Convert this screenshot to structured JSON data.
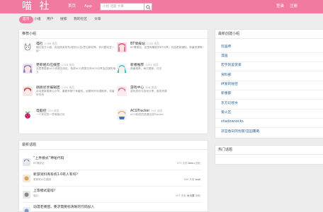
{
  "header": {
    "logo": "喵 社",
    "nav": [
      "首页",
      "App"
    ],
    "search_placeholder": "小组 话题 文章",
    "login": "登录",
    "register": "注册"
  },
  "subnav": [
    "首页",
    "小组",
    "用户",
    "搜索",
    "我的社区",
    "文章"
  ],
  "recommend": {
    "title": "推荐小组",
    "groups": [
      {
        "name": "喵社",
        "count": "1186 成员",
        "desc": "喵社官方小组，欢迎使用发布/规则/公告/意见和帖等，有问题也在一起~",
        "avatar": "cat"
      },
      {
        "name": "BT情报站",
        "count": "1150 成员",
        "desc": "BT情报站，这里有最新的BT分享，包括更新通知、新番资源等~",
        "avatar": "pink"
      },
      {
        "name": "更新姬の应援团",
        "count": "1128 成员",
        "desc": "这里是更新ACG资源交流区，各类ACG资源交流ACG分享及应援的地方",
        "avatar": "purple"
      },
      {
        "name": "新番推荐",
        "count": "1031 成员",
        "desc": "新番推荐，每日更新，讨论",
        "avatar": "miku"
      },
      {
        "name": "搞搞优享编辑团",
        "count": "1150 成员",
        "desc": "欢迎更新推荐公众号，看看有哪个有趣的，如果有好动漫推荐，或者好东西",
        "avatar": "redhead"
      },
      {
        "name": "游戏中心",
        "count": "408 成员",
        "desc": "游戏资讯与游戏分享，各类资源",
        "avatar": "bluehair"
      },
      {
        "name": "电脑控",
        "count": "370 成员",
        "desc": "一个死宅的一些电脑讨论",
        "avatar": "raspberry"
      },
      {
        "name": "ACGTracker",
        "count": "341 成员",
        "desc": "ACG相关的资源交流Tracker",
        "avatar": "girl"
      }
    ]
  },
  "latest": {
    "title": "最新话题",
    "topics": [
      {
        "title": "“上界模式”神秘代码",
        "group": "BT情报站",
        "replies": "373 天前",
        "user": "Akku",
        "time": "回帖"
      },
      {
        "title": "新游资料库系统1.0有人有吗？",
        "group": "更新姬の应援团",
        "replies": "380 天前",
        "user": "sopi",
        "time": ""
      },
      {
        "title": "上等模式是啥？",
        "group": "喵社",
        "replies": "407 天前",
        "user": "木月素",
        "time": "回帖"
      },
      {
        "title": "动漫老婆图，要求需要标清晰的代码加入",
        "group": "",
        "replies": "",
        "user": "",
        "time": ""
      }
    ]
  },
  "newgroups": {
    "title": "最新创建小组",
    "items": [
      "玩画师",
      "漫画",
      "宏宇的鉴赏家",
      "资料部",
      "绊爱的秘密",
      "新番部",
      "东方幻想乡",
      "第火区",
      "shadowsocks",
      "凉宫春日的忧郁/宫园薰哉"
    ]
  },
  "hot": {
    "title": "热门话题"
  },
  "colors": {
    "brand": "#f07aa0",
    "link": "#2a6496"
  }
}
